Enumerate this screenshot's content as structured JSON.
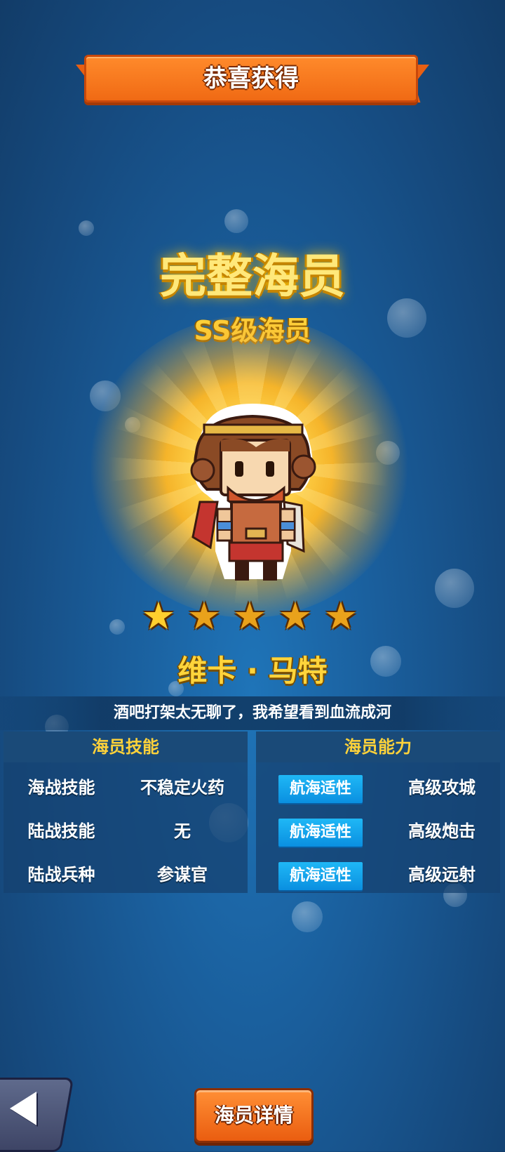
{
  "banner": {
    "title": "恭喜获得"
  },
  "reward": {
    "title": "完整海员",
    "grade": "SS级海员",
    "stars": 5,
    "character_name": "维卡 · 马特",
    "quote": "酒吧打架太无聊了，我希望看到血流成河"
  },
  "skills_panel": {
    "header": "海员技能",
    "rows": [
      {
        "label": "海战技能",
        "value": "不稳定火药"
      },
      {
        "label": "陆战技能",
        "value": "无"
      },
      {
        "label": "陆战兵种",
        "value": "参谋官"
      }
    ]
  },
  "ability_panel": {
    "header": "海员能力",
    "rows": [
      {
        "badge": "航海适性",
        "value": "高级攻城"
      },
      {
        "badge": "航海适性",
        "value": "高级炮击"
      },
      {
        "badge": "航海适性",
        "value": "高级远射"
      }
    ]
  },
  "buttons": {
    "detail": "海员详情",
    "back_icon": "back-arrow-icon"
  },
  "colors": {
    "gold": "#ffd23a",
    "orange": "#f06a14",
    "panel_blue": "#1a4a78",
    "badge_blue": "#1fb8f6"
  }
}
